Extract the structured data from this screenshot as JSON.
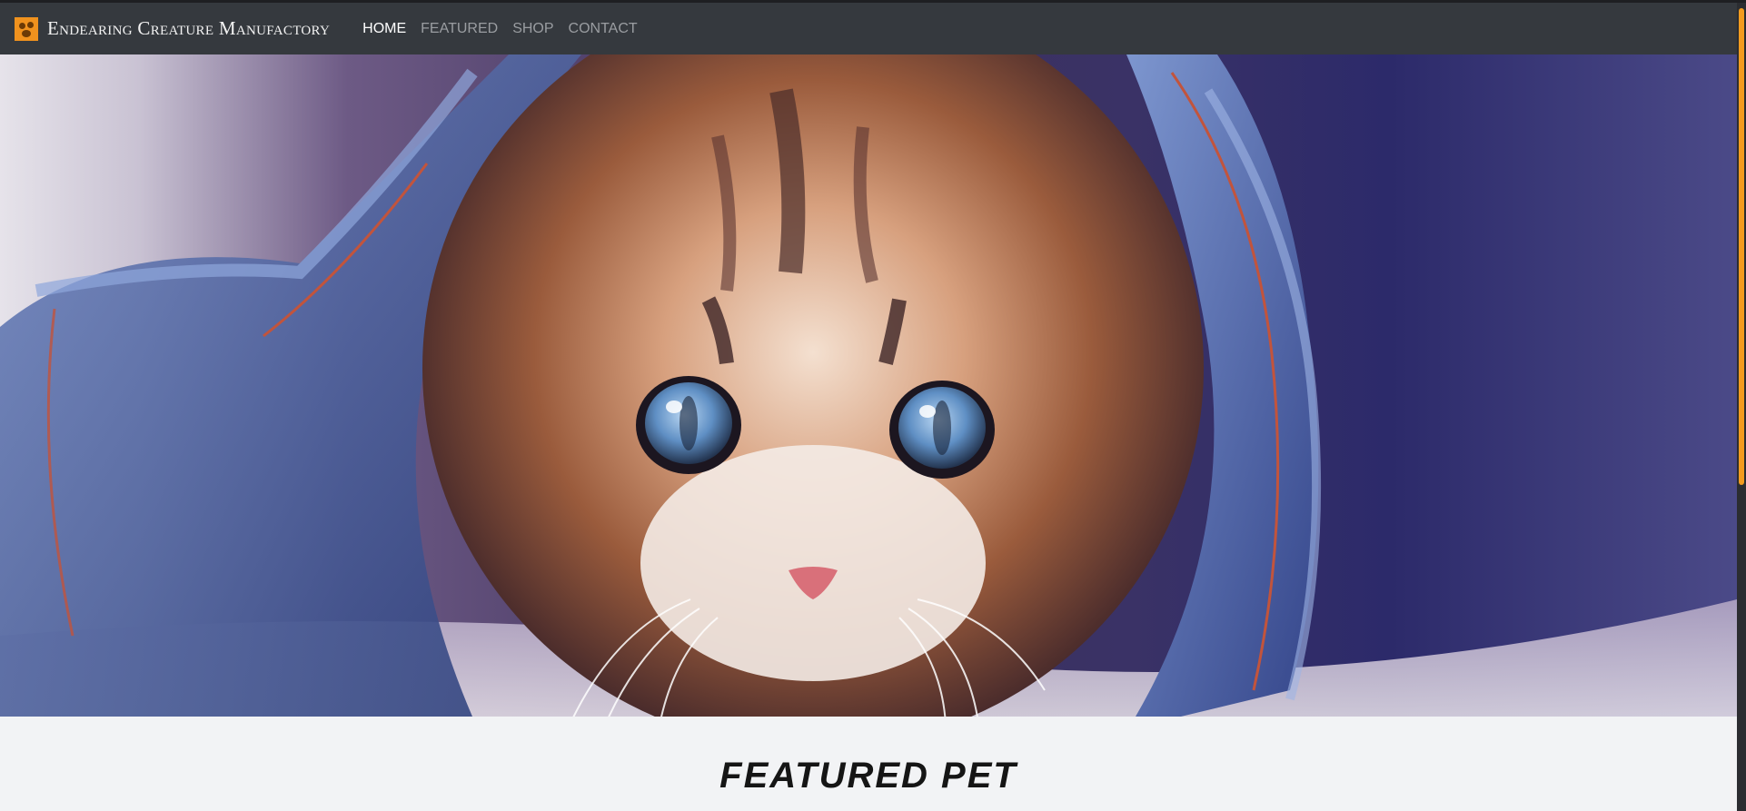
{
  "brand": {
    "name": "Endearing Creature Manufactory",
    "logo_icon": "paw-logo-icon"
  },
  "nav": {
    "items": [
      {
        "label": "HOME",
        "active": true
      },
      {
        "label": "FEATURED",
        "active": false
      },
      {
        "label": "SHOP",
        "active": false
      },
      {
        "label": "CONTACT",
        "active": false
      }
    ]
  },
  "hero": {
    "image": "kitten-in-denim-photo"
  },
  "section": {
    "title": "FEATURED PET"
  },
  "colors": {
    "navbar": "#35393e",
    "accent": "#f0921e",
    "section_bg": "#f2f3f5"
  }
}
